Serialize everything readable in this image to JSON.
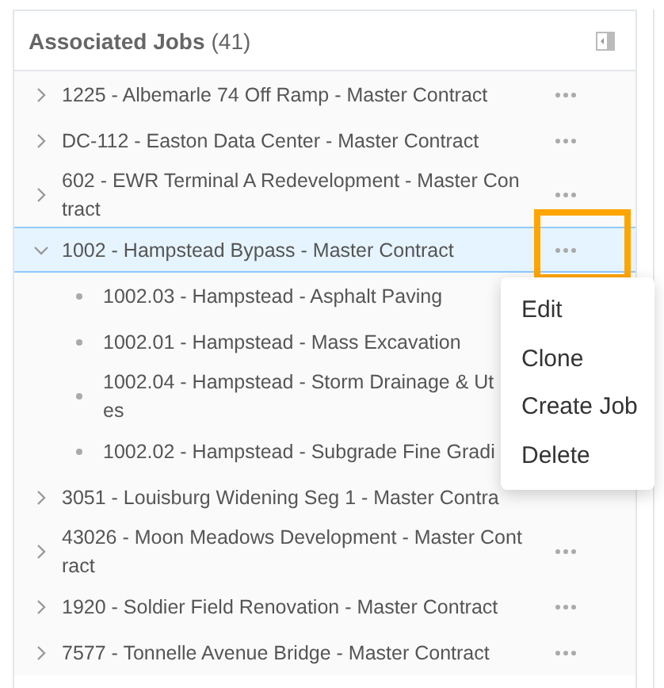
{
  "panel": {
    "title": "Associated Jobs",
    "count": "(41)"
  },
  "jobs": [
    {
      "kind": "job",
      "lines": [
        "1225 - Albemarle 74 Off Ramp - Master Contract"
      ],
      "expanded": false,
      "selected": false,
      "more": true
    },
    {
      "kind": "job",
      "lines": [
        "DC-112 - Easton Data Center - Master Contract"
      ],
      "expanded": false,
      "selected": false,
      "more": true
    },
    {
      "kind": "job",
      "lines": [
        "602 - EWR Terminal A Redevelopment - Master Con",
        "tract"
      ],
      "expanded": false,
      "selected": false,
      "more": true
    },
    {
      "kind": "job",
      "lines": [
        "1002 - Hampstead Bypass - Master Contract"
      ],
      "expanded": true,
      "selected": true,
      "more": true,
      "highlighted": true
    },
    {
      "kind": "phase",
      "lines": [
        "1002.03 - Hampstead - Asphalt Paving"
      ]
    },
    {
      "kind": "phase",
      "lines": [
        "1002.01 - Hampstead - Mass Excavation"
      ]
    },
    {
      "kind": "phase",
      "lines": [
        "1002.04 - Hampstead - Storm Drainage & Ut",
        "es"
      ]
    },
    {
      "kind": "phase",
      "lines": [
        "1002.02 - Hampstead - Subgrade Fine Gradi"
      ]
    },
    {
      "kind": "job",
      "lines": [
        "3051 - Louisburg Widening Seg 1 - Master Contra"
      ],
      "expanded": false,
      "selected": false,
      "more": false
    },
    {
      "kind": "job",
      "lines": [
        "43026 - Moon Meadows Development - Master Cont",
        "ract"
      ],
      "expanded": false,
      "selected": false,
      "more": true
    },
    {
      "kind": "job",
      "lines": [
        "1920 - Soldier Field Renovation - Master Contract"
      ],
      "expanded": false,
      "selected": false,
      "more": true
    },
    {
      "kind": "job",
      "lines": [
        "7577 - Tonnelle Avenue Bridge - Master Contract"
      ],
      "expanded": false,
      "selected": false,
      "more": true
    }
  ],
  "menu": [
    "Edit",
    "Clone",
    "Create Job",
    "Delete"
  ]
}
